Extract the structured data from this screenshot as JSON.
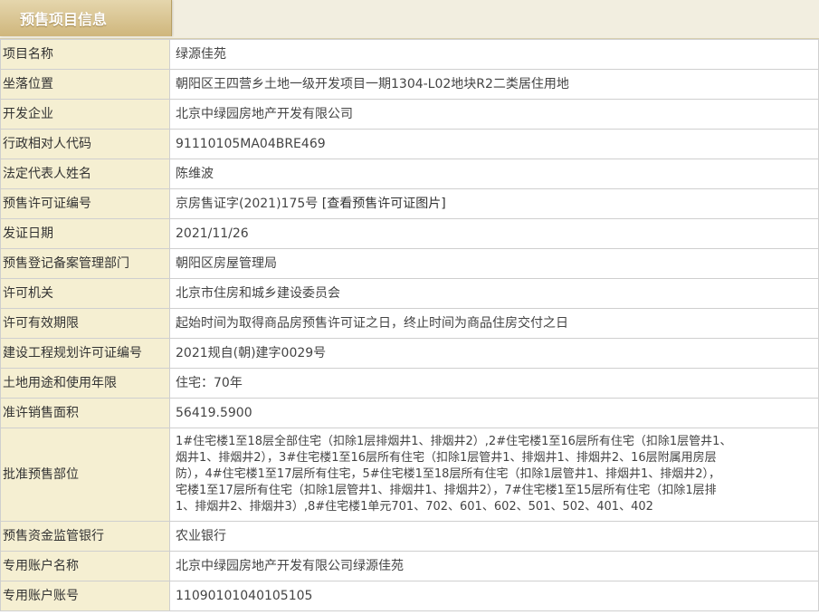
{
  "header": {
    "title": "预售项目信息"
  },
  "rows": [
    {
      "label": "项目名称",
      "value": "绿源佳苑"
    },
    {
      "label": "坐落位置",
      "value": "朝阳区王四营乡土地一级开发项目一期1304-L02地块R2二类居住用地"
    },
    {
      "label": "开发企业",
      "value": "北京中绿园房地产开发有限公司"
    },
    {
      "label": "行政相对人代码",
      "value": "91110105MA04BRE469"
    },
    {
      "label": "法定代表人姓名",
      "value": "陈维波"
    },
    {
      "label": "预售许可证编号",
      "value": "京房售证字(2021)175号",
      "link": "[查看预售许可证图片]"
    },
    {
      "label": "发证日期",
      "value": "2021/11/26"
    },
    {
      "label": "预售登记备案管理部门",
      "value": "朝阳区房屋管理局"
    },
    {
      "label": "许可机关",
      "value": "北京市住房和城乡建设委员会"
    },
    {
      "label": "许可有效期限",
      "value": "起始时间为取得商品房预售许可证之日，终止时间为商品住房交付之日"
    },
    {
      "label": "建设工程规划许可证编号",
      "value": "2021规自(朝)建字0029号"
    },
    {
      "label": "土地用途和使用年限",
      "value": "住宅：70年"
    },
    {
      "label": "准许销售面积",
      "value": "56419.5900"
    }
  ],
  "presale_scope": {
    "label": "批准预售部位",
    "lines": [
      "1#住宅楼1至18层全部住宅（扣除1层排烟井1、排烟井2）,2#住宅楼1至16层所有住宅（扣除1层管井1、",
      "烟井1、排烟井2），3#住宅楼1至16层所有住宅（扣除1层管井1、排烟井1、排烟井2、16层附属用房层",
      "防），4#住宅楼1至17层所有住宅，5#住宅楼1至18层所有住宅（扣除1层管井1、排烟井1、排烟井2），",
      "宅楼1至17层所有住宅（扣除1层管井1、排烟井1、排烟井2），7#住宅楼1至15层所有住宅（扣除1层排",
      "1、排烟井2、排烟井3）,8#住宅楼1单元701、702、601、602、501、502、401、402"
    ]
  },
  "rows2": [
    {
      "label": "预售资金监管银行",
      "value": "农业银行"
    },
    {
      "label": "专用账户名称",
      "value": "北京中绿园房地产开发有限公司绿源佳苑"
    },
    {
      "label": "专用账户账号",
      "value": "11090101040105105"
    }
  ]
}
